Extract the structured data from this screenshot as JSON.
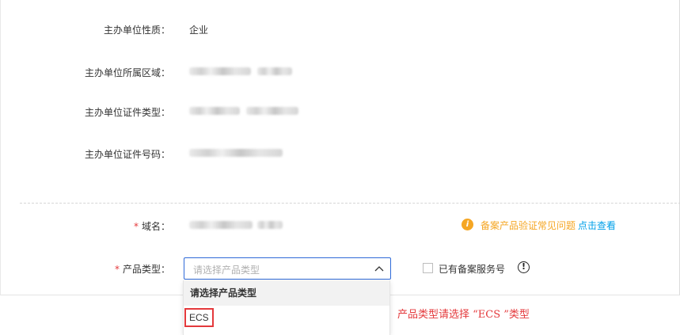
{
  "form": {
    "org_nature": {
      "label": "主办单位性质：",
      "value": "企业"
    },
    "org_region": {
      "label": "主办单位所属区域："
    },
    "org_cert_type": {
      "label": "主办单位证件类型："
    },
    "org_cert_number": {
      "label": "主办单位证件号码："
    },
    "domain": {
      "label": "域名：",
      "required_mark": "*"
    },
    "product_type": {
      "label": "产品类型：",
      "required_mark": "*",
      "placeholder": "请选择产品类型",
      "options": [
        "请选择产品类型",
        "ECS"
      ],
      "chevron_icon": "chevron-up-icon"
    },
    "existing_service_number": {
      "label": "已有备案服务号",
      "help_icon": "help-icon"
    }
  },
  "info": {
    "icon": "info-icon",
    "text": "备案产品验证常见问题",
    "link": "点击查看"
  },
  "annotation": {
    "text": "产品类型请选择 “ECS ”类型"
  },
  "colors": {
    "required": "#e4393c",
    "info_orange": "#f5a623",
    "link_blue": "#00a0e9",
    "focus_border": "#2f6ad8",
    "annotation_red": "#e4393c"
  }
}
